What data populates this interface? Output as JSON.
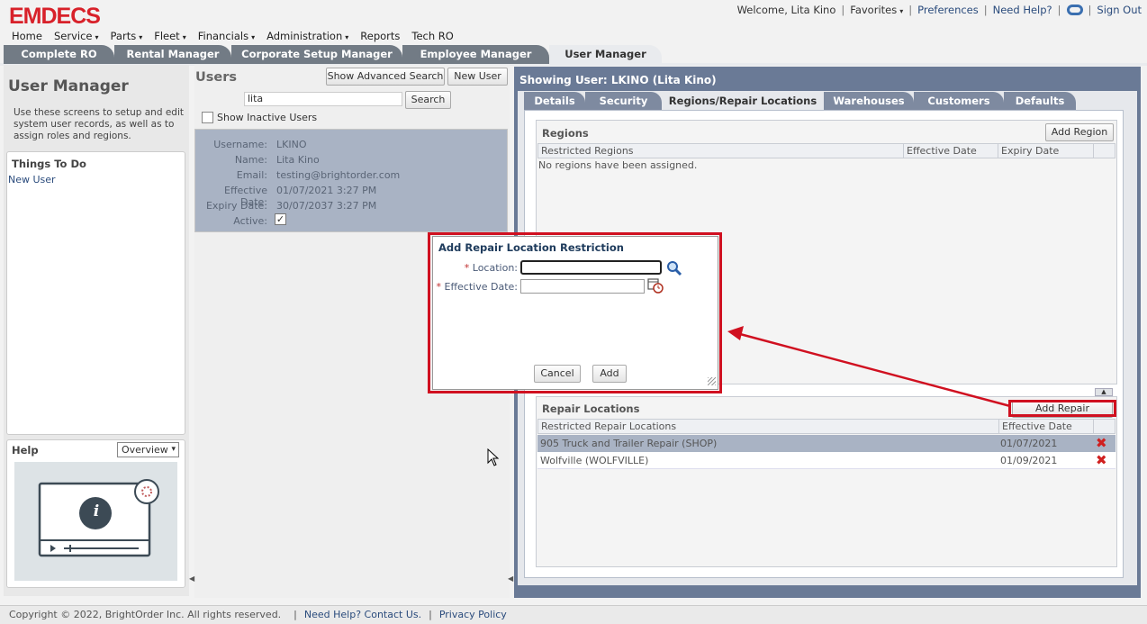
{
  "app": {
    "logo": "EMDECS"
  },
  "topbar": {
    "welcome": "Welcome, Lita Kino",
    "favorites": "Favorites",
    "preferences": "Preferences",
    "need_help": "Need Help?",
    "sign_out": "Sign Out",
    "sep": "|"
  },
  "nav": {
    "items": [
      "Home",
      "Service",
      "Parts",
      "Fleet",
      "Financials",
      "Administration",
      "Reports",
      "Tech RO"
    ],
    "caret": "▾"
  },
  "tabs": [
    "Complete RO",
    "Rental Manager",
    "Corporate Setup Manager",
    "Employee Manager",
    "User Manager"
  ],
  "left_panel": {
    "title": "User Manager",
    "description": "Use these screens to setup and edit system user records, as well as to assign roles and regions.",
    "things_to_do": {
      "header": "Things To Do",
      "items": [
        "New User"
      ]
    },
    "help": {
      "header": "Help",
      "select_value": "Overview",
      "info_glyph": "i"
    }
  },
  "users_panel": {
    "title": "Users",
    "advanced_search_label": "Show Advanced Search",
    "new_user_label": "New User",
    "search_value": "lita",
    "search_button": "Search",
    "show_inactive_label": "Show Inactive Users",
    "selected_user": {
      "username_label": "Username:",
      "username": "LKINO",
      "name_label": "Name:",
      "name": "Lita Kino",
      "email_label": "Email:",
      "email": "testing@brightorder.com",
      "effective_label": "Effective Date:",
      "effective": "01/07/2021 3:27 PM",
      "expiry_label": "Expiry Date:",
      "expiry": "30/07/2037 3:27 PM",
      "active_label": "Active:",
      "check_glyph": "✓"
    }
  },
  "detail": {
    "header": "Showing User: LKINO (Lita Kino)",
    "tabs": [
      "Details",
      "Security",
      "Regions/Repair Locations",
      "Warehouses",
      "Customers",
      "Defaults"
    ],
    "regions": {
      "title": "Regions",
      "add_label": "Add Region",
      "columns": [
        "Restricted Regions",
        "Effective Date",
        "Expiry Date"
      ],
      "empty_message": "No regions have been assigned."
    },
    "repair_locations": {
      "title": "Repair Locations",
      "add_label": "Add Repair Location",
      "columns": [
        "Restricted Repair Locations",
        "Effective Date"
      ],
      "rows": [
        {
          "location": "905 Truck and Trailer Repair (SHOP)",
          "date": "01/07/2021"
        },
        {
          "location": "Wolfville (WOLFVILLE)",
          "date": "01/09/2021"
        }
      ],
      "delete_glyph": "✖"
    }
  },
  "dialog": {
    "title": "Add Repair Location Restriction",
    "required_mark": "*",
    "location_label": "Location:",
    "location_value": "",
    "effective_label": "Effective Date:",
    "effective_value": "",
    "cancel_label": "Cancel",
    "add_label": "Add"
  },
  "footer": {
    "copyright": "Copyright © 2022, BrightOrder Inc. All rights reserved.",
    "contact": "Need Help? Contact Us.",
    "privacy": "Privacy Policy",
    "sep": "|"
  },
  "colors": {
    "brand_red": "#d8212a",
    "highlight_red": "#d01020",
    "frame_blue": "#6a7a96",
    "selected_row": "#a9b3c4"
  }
}
